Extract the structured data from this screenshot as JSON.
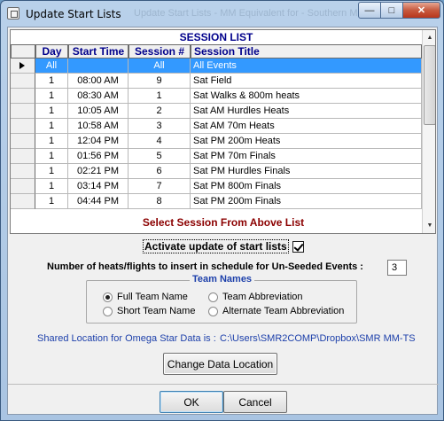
{
  "window": {
    "title": "Update Start Lists",
    "ghost_title": "Update Start Lists - MM Equivalent for - Southern Miss..."
  },
  "grid": {
    "caption": "SESSION LIST",
    "columns": [
      "Day",
      "Start Time",
      "Session #",
      "Session Title"
    ],
    "rows": [
      {
        "day": "All",
        "time": "",
        "num": "All",
        "title": "All Events",
        "selected": true
      },
      {
        "day": "1",
        "time": "08:00 AM",
        "num": "9",
        "title": "Sat Field"
      },
      {
        "day": "1",
        "time": "08:30 AM",
        "num": "1",
        "title": "Sat Walks & 800m heats"
      },
      {
        "day": "1",
        "time": "10:05 AM",
        "num": "2",
        "title": "Sat AM Hurdles Heats"
      },
      {
        "day": "1",
        "time": "10:58 AM",
        "num": "3",
        "title": "Sat AM 70m Heats"
      },
      {
        "day": "1",
        "time": "12:04 PM",
        "num": "4",
        "title": "Sat PM 200m Heats"
      },
      {
        "day": "1",
        "time": "01:56 PM",
        "num": "5",
        "title": "Sat PM 70m Finals"
      },
      {
        "day": "1",
        "time": "02:21 PM",
        "num": "6",
        "title": "Sat PM Hurdles Finals"
      },
      {
        "day": "1",
        "time": "03:14 PM",
        "num": "7",
        "title": "Sat PM 800m Finals"
      },
      {
        "day": "1",
        "time": "04:44 PM",
        "num": "8",
        "title": "Sat PM 200m Finals"
      }
    ]
  },
  "select_label": "Select Session From Above List",
  "activate": {
    "label": "Activate update of start lists",
    "checked": true
  },
  "heats": {
    "label": "Number of heats/flights to insert in schedule for Un-Seeded Events :",
    "value": "3"
  },
  "team_names": {
    "legend": "Team Names",
    "options": [
      {
        "label": "Full Team Name",
        "checked": true
      },
      {
        "label": "Team Abbreviation",
        "checked": false
      },
      {
        "label": "Short Team Name",
        "checked": false
      },
      {
        "label": "Alternate Team Abbreviation",
        "checked": false
      }
    ]
  },
  "shared_location": {
    "label": "Shared Location for Omega Star Data is :",
    "path": "C:\\Users\\SMR2COMP\\Dropbox\\SMR MM-TS"
  },
  "buttons": {
    "change_location": "Change Data Location",
    "ok": "OK",
    "cancel": "Cancel"
  },
  "colors": {
    "header_text": "#00008b",
    "selection": "#3399ff",
    "instruction": "#8b0000",
    "group_text": "#1c3faa"
  },
  "icons": [
    "app-icon",
    "minimize-icon",
    "maximize-icon",
    "close-icon",
    "row-pointer-icon",
    "scroll-up-icon",
    "scroll-down-icon"
  ]
}
